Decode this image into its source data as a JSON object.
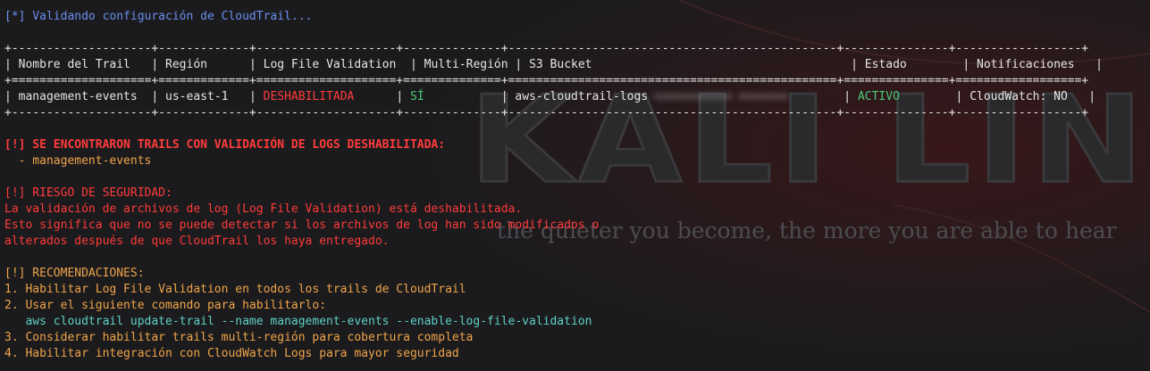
{
  "wallpaper": {
    "brand_text": "KALI LINUX",
    "motto": "the quieter you become, the more you are able to hear"
  },
  "header": "[*] Validando configuración de CloudTrail...",
  "table": {
    "border": "+--------------------+-------------+--------------------+--------------+-----------------------------------------------+---------------+------------------+",
    "double_border": "+====================+=============+====================+==============+===============================================+===============+==================+",
    "columns": [
      "Nombre del Trail",
      "Región",
      "Log File Validation",
      "Multi-Región",
      "S3 Bucket",
      "Estado",
      "Notificaciones"
    ],
    "row": {
      "name": "management-events",
      "region": "us-east-1",
      "log_validation": "DESHABILITADA",
      "multi_region": "SÍ",
      "bucket": "aws-cloudtrail-logs",
      "bucket_redacted": "-xxxxxxxxxxx-xxxxxxx",
      "status": "ACTIVO",
      "notifications": "CloudWatch: NO"
    }
  },
  "warning": {
    "title": "[!] SE ENCONTRARON TRAILS CON VALIDACIÓN DE LOGS DESHABILITADA:",
    "item": "  - management-events"
  },
  "risk": {
    "title": "[!] RIESGO DE SEGURIDAD:",
    "lines": [
      "La validación de archivos de log (Log File Validation) está deshabilitada.",
      "Esto significa que no se puede detectar si los archivos de log han sido modificados o",
      "alterados después de que CloudTrail los haya entregado."
    ]
  },
  "recommendations": {
    "title": "[!] RECOMENDACIONES:",
    "step1": "1. Habilitar Log File Validation en todos los trails de CloudTrail",
    "step2": "2. Usar el siguiente comando para habilitarlo:",
    "command": "   aws cloudtrail update-trail --name management-events --enable-log-file-validation",
    "step3": "3. Considerar habilitar trails multi-región para cobertura completa",
    "step4": "4. Habilitar integración con CloudWatch Logs para mayor seguridad"
  },
  "colors": {
    "background": "#1b1b1d",
    "info": "#6b8ff0",
    "error": "#ff3b3b",
    "advice": "#f0a44a",
    "ok": "#4ec97a",
    "command": "#5fd1c5"
  }
}
